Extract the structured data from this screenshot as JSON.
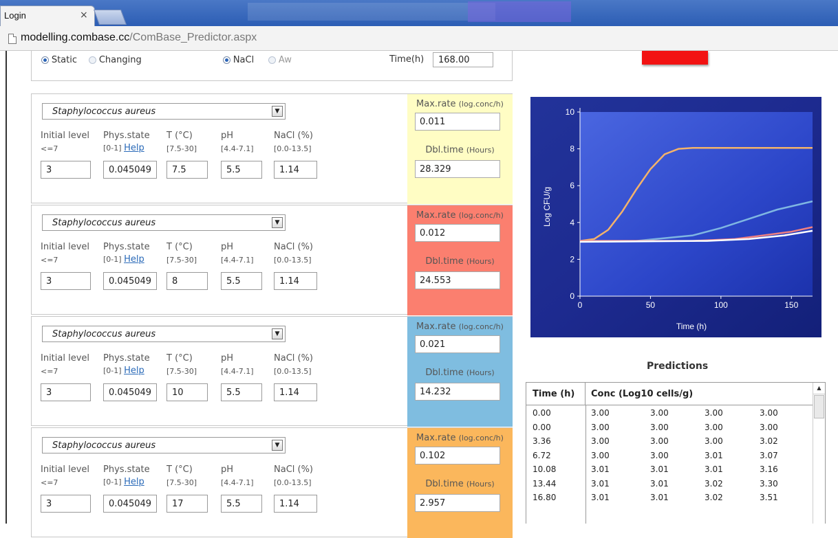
{
  "browser": {
    "tab_title": "Login",
    "tab_close": "×",
    "url_domain": "modelling.combase.cc",
    "url_path": "/ComBase_Predictor.aspx"
  },
  "top": {
    "static_label": "Static",
    "changing_label": "Changing",
    "nacl_label": "NaCl",
    "aw_label": "Aw",
    "time_label": "Time(h)",
    "time_value": "168.00"
  },
  "headers": {
    "initial_level": "Initial level",
    "initial_range": "<=7",
    "phys_state": "Phys.state",
    "phys_range": "[0-1]",
    "help": "Help",
    "temp": "T (°C)",
    "temp_range": "[7.5-30]",
    "ph": "pH",
    "ph_range": "[4.4-7.1]",
    "nacl": "NaCl (%)",
    "nacl_range": "[0.0-13.5]",
    "maxrate": "Max.rate",
    "maxrate_unit": "(log.conc/h)",
    "dbltime": "Dbl.time",
    "dbltime_unit": "(Hours)"
  },
  "panels": [
    {
      "organism": "Staphylococcus aureus",
      "initial": "3",
      "phys": "0.045049",
      "temp": "7.5",
      "ph": "5.5",
      "nacl": "1.14",
      "maxrate": "0.011",
      "dbltime": "28.329",
      "color": "#fffdc4"
    },
    {
      "organism": "Staphylococcus aureus",
      "initial": "3",
      "phys": "0.045049",
      "temp": "8",
      "ph": "5.5",
      "nacl": "1.14",
      "maxrate": "0.012",
      "dbltime": "24.553",
      "color": "#fb7f6f"
    },
    {
      "organism": "Staphylococcus aureus",
      "initial": "3",
      "phys": "0.045049",
      "temp": "10",
      "ph": "5.5",
      "nacl": "1.14",
      "maxrate": "0.021",
      "dbltime": "14.232",
      "color": "#7fbde0"
    },
    {
      "organism": "Staphylococcus aureus",
      "initial": "3",
      "phys": "0.045049",
      "temp": "17",
      "ph": "5.5",
      "nacl": "1.14",
      "maxrate": "0.102",
      "dbltime": "2.957",
      "color": "#fbb75c"
    }
  ],
  "chart_data": {
    "type": "line",
    "xlabel": "Time (h)",
    "ylabel": "Log CFU/g",
    "xlim": [
      0,
      165
    ],
    "ylim": [
      0,
      10
    ],
    "xticks": [
      "0",
      "50",
      "100",
      "150"
    ],
    "yticks": [
      "0",
      "2",
      "4",
      "6",
      "8",
      "10"
    ],
    "series": [
      {
        "color": "#f4b36a",
        "points": [
          [
            0,
            3
          ],
          [
            10,
            3.1
          ],
          [
            20,
            3.6
          ],
          [
            30,
            4.6
          ],
          [
            40,
            5.8
          ],
          [
            50,
            6.9
          ],
          [
            60,
            7.7
          ],
          [
            70,
            8.0
          ],
          [
            80,
            8.05
          ],
          [
            165,
            8.05
          ]
        ]
      },
      {
        "color": "#7fb6e2",
        "points": [
          [
            0,
            3
          ],
          [
            40,
            3.0
          ],
          [
            80,
            3.3
          ],
          [
            100,
            3.7
          ],
          [
            120,
            4.2
          ],
          [
            140,
            4.7
          ],
          [
            165,
            5.15
          ]
        ]
      },
      {
        "color": "#f08080",
        "points": [
          [
            0,
            3
          ],
          [
            80,
            3.0
          ],
          [
            110,
            3.1
          ],
          [
            130,
            3.3
          ],
          [
            150,
            3.5
          ],
          [
            165,
            3.75
          ]
        ]
      },
      {
        "color": "#ffffff",
        "points": [
          [
            0,
            2.95
          ],
          [
            90,
            3.0
          ],
          [
            120,
            3.1
          ],
          [
            145,
            3.3
          ],
          [
            165,
            3.55
          ]
        ]
      }
    ]
  },
  "predictions": {
    "title": "Predictions",
    "col_time": "Time (h)",
    "col_conc": "Conc (Log10 cells/g)",
    "rows": [
      [
        "0.00",
        "3.00",
        "3.00",
        "3.00",
        "3.00"
      ],
      [
        "0.00",
        "3.00",
        "3.00",
        "3.00",
        "3.00"
      ],
      [
        "3.36",
        "3.00",
        "3.00",
        "3.00",
        "3.02"
      ],
      [
        "6.72",
        "3.00",
        "3.00",
        "3.01",
        "3.07"
      ],
      [
        "10.08",
        "3.01",
        "3.01",
        "3.01",
        "3.16"
      ],
      [
        "13.44",
        "3.01",
        "3.01",
        "3.02",
        "3.30"
      ],
      [
        "16.80",
        "3.01",
        "3.01",
        "3.02",
        "3.51"
      ]
    ]
  }
}
